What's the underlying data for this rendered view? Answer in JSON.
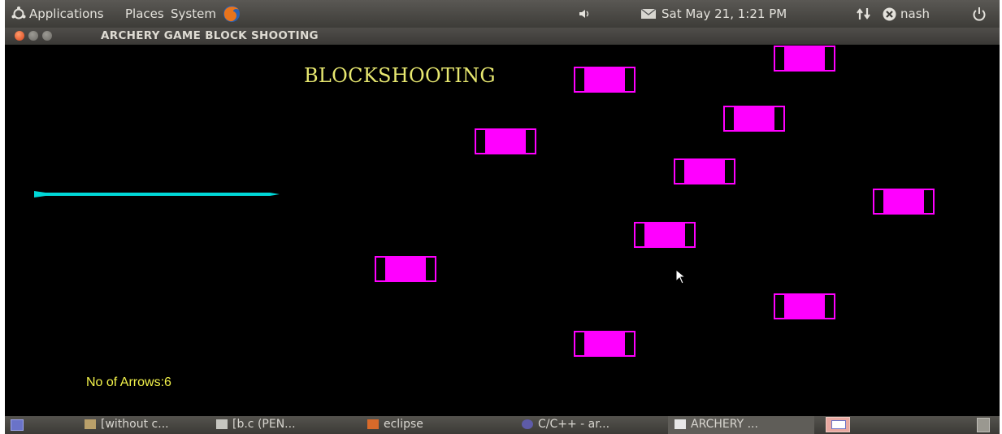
{
  "panel": {
    "applications": "Applications",
    "places": "Places",
    "system": "System",
    "clock": "Sat May 21,  1:21 PM",
    "user": "nash",
    "icons": [
      "ubuntu-logo-icon",
      "firefox-icon",
      "volume-icon",
      "mail-icon",
      "network-icon",
      "user-status-icon",
      "power-icon"
    ]
  },
  "window": {
    "title": "ARCHERY GAME BLOCK SHOOTING",
    "buttons": [
      "close",
      "minimize",
      "maximize"
    ]
  },
  "game": {
    "title": "BLOCKSHOOTING",
    "arrows_label": "No of Arrows:",
    "arrows_count": "6",
    "block_count": 10,
    "colors": {
      "block": "#ff00ff",
      "arrow": "#00d8d8",
      "text": "#f2f24a",
      "background": "#000000"
    }
  },
  "taskbar": {
    "items": [
      "[without c...",
      "[b.c (PEN...",
      "eclipse",
      "C/C++ - ar...",
      "ARCHERY ..."
    ],
    "icons": [
      "show-desktop-icon",
      "folder-icon",
      "editor-icon",
      "folder-icon",
      "eclipse-icon",
      "window-icon",
      "workspace-icon",
      "trash-icon"
    ]
  }
}
